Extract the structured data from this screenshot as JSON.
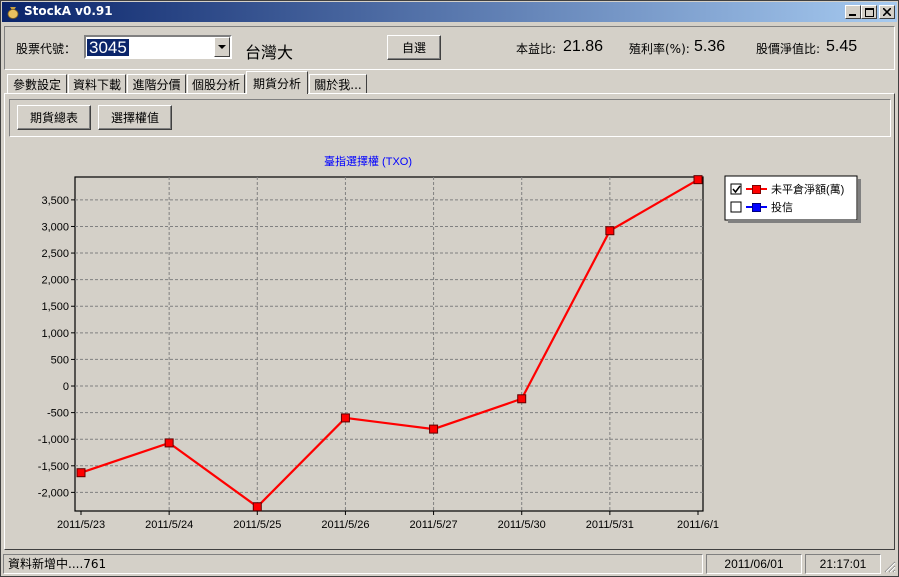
{
  "window": {
    "title": "StockA v0.91"
  },
  "header": {
    "stock_code_label": "股票代號：",
    "stock_code_value": "3045",
    "company_name": "台灣大",
    "watchlist_button": "自選",
    "pe_label": "本益比:",
    "pe_value": "21.86",
    "yield_label": "殖利率(%):",
    "yield_value": "5.36",
    "pb_label": "股價淨值比:",
    "pb_value": "5.45"
  },
  "tabs": [
    {
      "label": "參數設定"
    },
    {
      "label": "資料下載"
    },
    {
      "label": "進階分價"
    },
    {
      "label": "個股分析"
    },
    {
      "label": "期貨分析",
      "active": true
    },
    {
      "label": "關於我..."
    }
  ],
  "subtoolbar": {
    "futures_summary_button": "期貨總表",
    "options_value_button": "選擇權值"
  },
  "chart_data": {
    "type": "line",
    "title": "臺指選擇權 (TXO)",
    "categories": [
      "2011/5/23",
      "2011/5/24",
      "2011/5/25",
      "2011/5/26",
      "2011/5/27",
      "2011/5/30",
      "2011/5/31",
      "2011/6/1"
    ],
    "series": [
      {
        "name": "未平倉淨額(萬)",
        "values": [
          -1630,
          -1070,
          -2270,
          -600,
          -810,
          -240,
          2920,
          3880
        ],
        "color": "#ff0000",
        "checked": true
      },
      {
        "name": "投信",
        "values": [],
        "color": "#0000ff",
        "checked": false
      }
    ],
    "y_ticks": [
      3500,
      3000,
      2500,
      2000,
      1500,
      1000,
      500,
      0,
      -500,
      -1000,
      -1500,
      -2000
    ],
    "y_tick_labels": [
      "3,500",
      "3,000",
      "2,500",
      "2,000",
      "1,500",
      "1,000",
      "500",
      "0",
      "-500",
      "-1,000",
      "-1,500",
      "-2,000"
    ],
    "ylim": [
      -2350,
      3930
    ],
    "grid": true,
    "legend_position": "top-right",
    "title_color": "#0000ff"
  },
  "statusbar": {
    "message": "資料新增中....761",
    "date": "2011/06/01",
    "time": "21:17:01"
  }
}
